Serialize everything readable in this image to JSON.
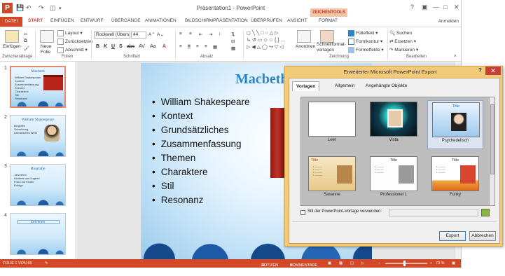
{
  "window": {
    "title": "Präsentation1 - PowerPoint",
    "tools_label": "ZEICHENTOOLS",
    "user": "Anmelden"
  },
  "tabs": [
    {
      "label": "DATEI"
    },
    {
      "label": "START"
    },
    {
      "label": "EINFÜGEN"
    },
    {
      "label": "ENTWURF"
    },
    {
      "label": "ÜBERGÄNGE"
    },
    {
      "label": "ANIMATIONEN"
    },
    {
      "label": "BILDSCHIRMPRÄSENTATION"
    },
    {
      "label": "ÜBERPRÜFEN"
    },
    {
      "label": "ANSICHT"
    },
    {
      "label": "FORMAT"
    }
  ],
  "ribbon": {
    "clipboard": {
      "paste": "Einfügen",
      "group": "Zwischenablage"
    },
    "slides": {
      "new": "Neue Folie",
      "layout": "Layout",
      "reset": "Zurücksetzen",
      "section": "Abschnitt",
      "group": "Folien"
    },
    "font": {
      "name": "Rockwell (Übers",
      "size": "44",
      "group": "Schriftart"
    },
    "paragraph": {
      "group": "Absatz"
    },
    "drawing": {
      "arrange": "Anordnen",
      "quickstyles": "Schnellformat-vorlagen",
      "fill": "Fülleffekt",
      "outline": "Formkontur",
      "effects": "Formeffekte",
      "group": "Zeichnung"
    },
    "editing": {
      "find": "Suchen",
      "replace": "Ersetzen",
      "select": "Markieren",
      "group": "Bearbeiten"
    }
  },
  "thumbnails": [
    {
      "num": "1",
      "title": "Macbeth",
      "bullets": [
        "William Shakespeare",
        "Kontext",
        "Zusammenfassung",
        "Themen",
        "Charaktere",
        "Stil",
        "Resonanz"
      ]
    },
    {
      "num": "2",
      "title": "William Shakespeare",
      "bullets": [
        "Biografie",
        "Schreibung",
        "Literarisches Werk"
      ]
    },
    {
      "num": "3",
      "title": "Biografie",
      "bullets": [
        "Jahrzehnt",
        "Kindheit und Jugend",
        "Frau und Kinder",
        "Erfolge"
      ]
    },
    {
      "num": "4",
      "title": "Zeichnen",
      "bullets": []
    }
  ],
  "slide": {
    "title": "Macbeth",
    "bullets": [
      "William Shakespeare",
      "Kontext",
      "Grundsätzliches",
      "Zusammenfassung",
      "Themen",
      "Charaktere",
      "Stil",
      "Resonanz"
    ]
  },
  "status": {
    "slide_info": "FOLIE 1 VON 65",
    "notes": "NOTIZEN",
    "comments": "KOMMENTARE",
    "zoom": "73 %"
  },
  "dialog": {
    "title": "Erweiterter Microsoft PowerPoint Export",
    "help": "?",
    "close": "✕",
    "tabs": [
      "Vorlagen",
      "Allgemein",
      "Angehängte Objekte"
    ],
    "templates": [
      {
        "name": "Leer"
      },
      {
        "name": "Vista"
      },
      {
        "name": "Psychedelisch",
        "mini_title": "Title"
      },
      {
        "name": "Savanne",
        "mini_title": "Title"
      },
      {
        "name": "Professionel 1",
        "mini_title": "Title"
      },
      {
        "name": "Funky",
        "mini_title": "Title"
      }
    ],
    "checkbox_label": "Stil der PowerPoint-Vorlage verwenden:",
    "export_button": "Export",
    "cancel_button": "Abbrechen"
  },
  "colors": {
    "accent": "#d24726",
    "dialog_frame": "#f3c97a",
    "slide_title": "#2a86c8"
  }
}
